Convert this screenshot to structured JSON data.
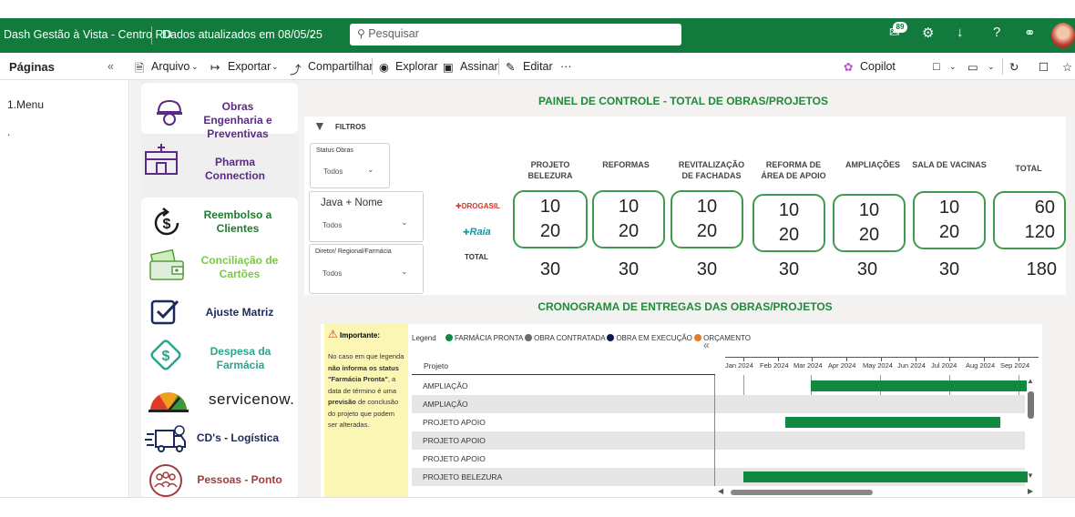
{
  "topbar": {
    "title": "Dash Gestão à Vista - Centro RD",
    "updated": "Dados atualizados em 08/05/25",
    "search_placeholder": "Pesquisar",
    "notif_count": "89"
  },
  "menubar": {
    "pages_label": "Páginas",
    "arquivo": "Arquivo",
    "exportar": "Exportar",
    "compartilhar": "Compartilhar",
    "explorar": "Explorar",
    "assinar": "Assinar",
    "editar": "Editar",
    "more": "···",
    "copilot": "Copilot"
  },
  "sidebar": {
    "items": [
      {
        "label": "1.Menu"
      },
      {
        "label": "."
      }
    ]
  },
  "nav": {
    "obras": "Obras Engenharia e Preventivas",
    "pharma": "Pharma Connection",
    "reembolso": "Reembolso a Clientes",
    "conciliacao": "Conciliação de Cartões",
    "ajuste": "Ajuste Matriz",
    "despesa": "Despesa da Farmácia",
    "servicenow": "servicenow.",
    "cds": "CD's - Logística",
    "pessoas": "Pessoas - Ponto"
  },
  "painel": {
    "title": "PAINEL DE CONTROLE - TOTAL DE OBRAS/PROJETOS",
    "filtros": "FILTROS",
    "filter_status_label": "Status Obras",
    "filter_status_value": "Todos",
    "filter_java_label": "Java + Nome",
    "filter_java_value": "Todos",
    "filter_diretor_label": "Diretor/ Regional/Farmácia",
    "filter_diretor_value": "Todos",
    "row_drogasil": "DROGASIL",
    "row_raia": "Raia",
    "row_total": "TOTAL",
    "columns": [
      {
        "header": "PROJETO BELEZURA",
        "drogasil": "10",
        "raia": "20",
        "total": "30"
      },
      {
        "header": "REFORMAS",
        "drogasil": "10",
        "raia": "20",
        "total": "30"
      },
      {
        "header": "REVITALIZAÇÃO DE FACHADAS",
        "drogasil": "10",
        "raia": "20",
        "total": "30"
      },
      {
        "header": "REFORMA DE ÁREA DE APOIO",
        "drogasil": "10",
        "raia": "20",
        "total": "30"
      },
      {
        "header": "AMPLIAÇÕES",
        "drogasil": "10",
        "raia": "20",
        "total": "30"
      },
      {
        "header": "SALA DE VACINAS",
        "drogasil": "10",
        "raia": "20",
        "total": "30"
      },
      {
        "header": "TOTAL",
        "drogasil": "60",
        "raia": "120",
        "total": "180"
      }
    ]
  },
  "cronograma": {
    "title": "CRONOGRAMA DE ENTREGAS DAS OBRAS/PROJETOS",
    "importante_title": "Importante:",
    "importante_p1": "No caso em que legenda ",
    "importante_b1": "não informa os status \"Farmácia Pronta\"",
    "importante_p2": ", a data de término é uma ",
    "importante_b2": "previsão",
    "importante_p3": " de conclusão do projeto que podem ser alteradas.",
    "legend_label": "Legend",
    "legend": [
      {
        "label": "FARMÁCIA PRONTA",
        "color": "#11893f"
      },
      {
        "label": "OBRA CONTRATADA",
        "color": "#6b6b6b"
      },
      {
        "label": "OBRA EM EXECUÇÃO",
        "color": "#0d1b4a"
      },
      {
        "label": "ORÇAMENTO",
        "color": "#e07a2e"
      }
    ],
    "col_projeto": "Projeto",
    "months": [
      "Jan 2024",
      "Feb 2024",
      "Mar 2024",
      "Apr 2024",
      "May 2024",
      "Jun 2024",
      "Jul 2024",
      "Aug 2024",
      "Sep 2024"
    ],
    "rows": [
      {
        "label": "AMPLIAÇÃO",
        "start": 1.95,
        "end": 8.2
      },
      {
        "label": "AMPLIAÇÃO",
        "start": null,
        "end": null
      },
      {
        "label": "PROJETO APOIO",
        "start": 1.2,
        "end": 7.4
      },
      {
        "label": "PROJETO APOIO",
        "start": null,
        "end": null
      },
      {
        "label": "PROJETO APOIO",
        "start": null,
        "end": null
      },
      {
        "label": "PROJETO BELEZURA",
        "start": 0.0,
        "end": 8.2
      }
    ]
  },
  "colors": {
    "brand_green": "#117a3c",
    "accent_green": "#11893f",
    "title_green": "#1f8a3a"
  }
}
